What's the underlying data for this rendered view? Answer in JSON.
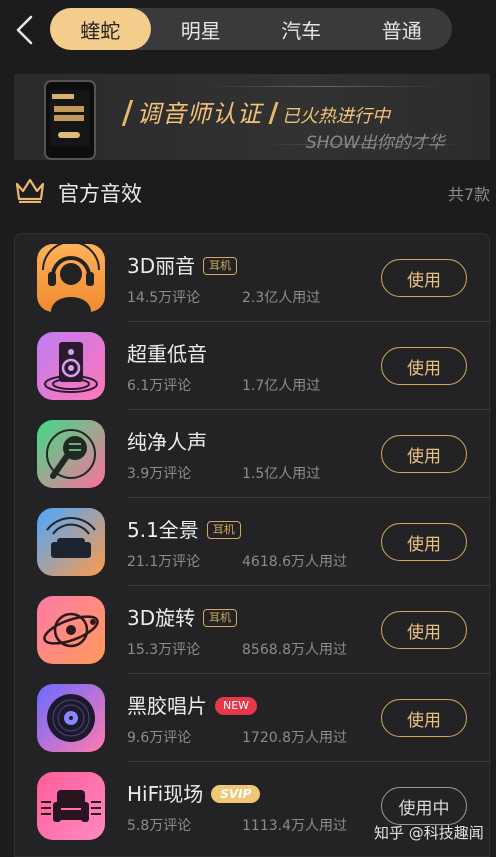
{
  "header": {
    "back_icon": "chevron-left-icon",
    "tabs": [
      {
        "label": "蝰蛇",
        "active": true
      },
      {
        "label": "明星",
        "active": false
      },
      {
        "label": "汽车",
        "active": false
      },
      {
        "label": "普通",
        "active": false
      }
    ]
  },
  "banner": {
    "title": "调音师认证",
    "subtitle": "已火热进行中",
    "tagline": "SHOW出你的才华"
  },
  "section": {
    "icon": "crown-icon",
    "title": "官方音效",
    "count": "共7款"
  },
  "effects": [
    {
      "name": "3D丽音",
      "badge": "耳机",
      "comments": "14.5万评论",
      "users": "2.3亿人用过",
      "button": "使用",
      "icon": "headphone-person-icon"
    },
    {
      "name": "超重低音",
      "badge": "",
      "comments": "6.1万评论",
      "users": "1.7亿人用过",
      "button": "使用",
      "icon": "speaker-icon"
    },
    {
      "name": "纯净人声",
      "badge": "",
      "comments": "3.9万评论",
      "users": "1.5亿人用过",
      "button": "使用",
      "icon": "microphone-icon"
    },
    {
      "name": "5.1全景",
      "badge": "耳机",
      "comments": "21.1万评论",
      "users": "4618.6万人用过",
      "button": "使用",
      "icon": "sofa-surround-icon"
    },
    {
      "name": "3D旋转",
      "badge": "耳机",
      "comments": "15.3万评论",
      "users": "8568.8万人用过",
      "button": "使用",
      "icon": "orbit-icon"
    },
    {
      "name": "黑胶唱片",
      "badge": "NEW",
      "comments": "9.6万评论",
      "users": "1720.8万人用过",
      "button": "使用",
      "icon": "vinyl-record-icon"
    },
    {
      "name": "HiFi现场",
      "badge": "SVIP",
      "comments": "5.8万评论",
      "users": "1113.4万人用过",
      "button": "使用中",
      "icon": "armchair-icon"
    }
  ],
  "watermark": "知乎 @科技趣闻",
  "colors": {
    "accent": "#f3cd8c",
    "button_border": "#d4a85e",
    "new_badge": "#e8374a",
    "svip_badge": "#efc775"
  }
}
